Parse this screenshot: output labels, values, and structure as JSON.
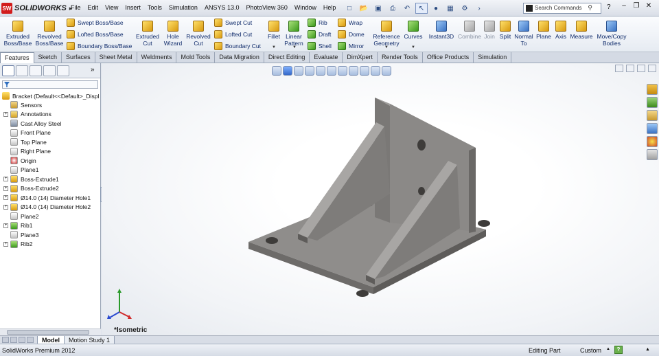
{
  "app": {
    "brand": "SOLIDWORKS",
    "brand_badge": "SW"
  },
  "menu": [
    "File",
    "Edit",
    "View",
    "Insert",
    "Tools",
    "Simulation",
    "ANSYS 13.0",
    "PhotoView 360",
    "Window",
    "Help"
  ],
  "search": {
    "placeholder": "Search Commands"
  },
  "ribbon": {
    "extruded_boss": "Extruded Boss/Base",
    "revolved_boss": "Revolved Boss/Base",
    "swept_boss": "Swept Boss/Base",
    "lofted_boss": "Lofted Boss/Base",
    "boundary_boss": "Boundary Boss/Base",
    "extruded_cut": "Extruded Cut",
    "hole_wizard": "Hole Wizard",
    "revolved_cut": "Revolved Cut",
    "swept_cut": "Swept Cut",
    "lofted_cut": "Lofted Cut",
    "boundary_cut": "Boundary Cut",
    "fillet": "Fillet",
    "linear_pattern": "Linear Pattern",
    "rib": "Rib",
    "draft": "Draft",
    "shell": "Shell",
    "wrap": "Wrap",
    "dome": "Dome",
    "mirror": "Mirror",
    "reference_geometry": "Reference Geometry",
    "curves": "Curves",
    "instant3d": "Instant3D",
    "combine": "Combine",
    "join": "Join",
    "split": "Split",
    "normal_to": "Normal To",
    "plane": "Plane",
    "axis": "Axis",
    "measure": "Measure",
    "move_copy": "Move/Copy Bodies"
  },
  "tabs": [
    "Features",
    "Sketch",
    "Surfaces",
    "Sheet Metal",
    "Weldments",
    "Mold Tools",
    "Data Migration",
    "Direct Editing",
    "Evaluate",
    "DimXpert",
    "Render Tools",
    "Office Products",
    "Simulation"
  ],
  "active_tab": "Features",
  "tree": {
    "root": "Bracket  (Default<<Default>_Displ",
    "items": [
      {
        "label": "Sensors",
        "icon": "sensor-icon",
        "expand": false
      },
      {
        "label": "Annotations",
        "icon": "annotations-icon",
        "expand": true
      },
      {
        "label": "Cast Alloy Steel",
        "icon": "material-icon",
        "expand": false
      },
      {
        "label": "Front Plane",
        "icon": "plane-icon",
        "expand": false
      },
      {
        "label": "Top Plane",
        "icon": "plane-icon",
        "expand": false
      },
      {
        "label": "Right Plane",
        "icon": "plane-icon",
        "expand": false
      },
      {
        "label": "Origin",
        "icon": "origin-icon",
        "expand": false
      },
      {
        "label": "Plane1",
        "icon": "plane-icon",
        "expand": false
      },
      {
        "label": "Boss-Extrude1",
        "icon": "extrude-icon",
        "expand": true
      },
      {
        "label": "Boss-Extrude2",
        "icon": "extrude-icon",
        "expand": true
      },
      {
        "label": "Ø14.0 (14) Diameter Hole1",
        "icon": "hole-icon",
        "expand": true
      },
      {
        "label": "Ø14.0 (14) Diameter Hole2",
        "icon": "hole-icon",
        "expand": true
      },
      {
        "label": "Plane2",
        "icon": "plane-icon",
        "expand": false
      },
      {
        "label": "Rib1",
        "icon": "rib-icon",
        "expand": true
      },
      {
        "label": "Plane3",
        "icon": "plane-icon",
        "expand": false
      },
      {
        "label": "Rib2",
        "icon": "rib-icon",
        "expand": true
      }
    ]
  },
  "graphics": {
    "view_label": "*Isometric"
  },
  "bottom_tabs": [
    "Model",
    "Motion Study 1"
  ],
  "status": {
    "product": "SolidWorks Premium 2012",
    "mode": "Editing Part",
    "units": "Custom"
  },
  "colors": {
    "part": "#8a8886",
    "part_light": "#a8a6a4",
    "part_dark": "#5e5c5a",
    "tab_accent": "#ffffff"
  }
}
